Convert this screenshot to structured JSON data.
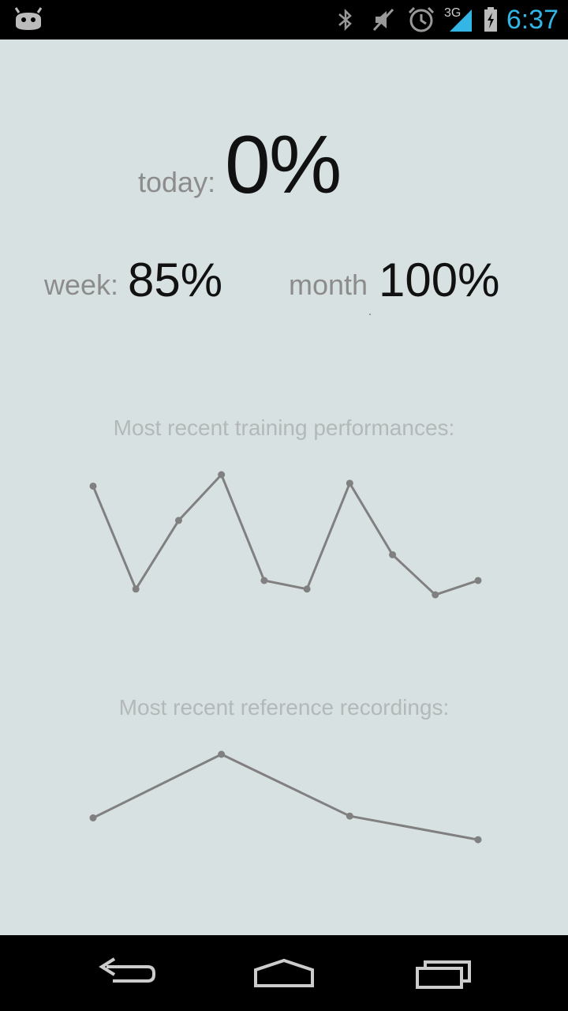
{
  "status_bar": {
    "time": "6:37",
    "network": "3G",
    "icons": [
      "android-icon",
      "bluetooth-icon",
      "mute-icon",
      "alarm-icon",
      "signal-icon",
      "battery-charging-icon"
    ]
  },
  "stats": {
    "today_label": "today:",
    "today_value": "0%",
    "week_label": "week:",
    "week_value": "85%",
    "month_label": "month",
    "month_value": "100%"
  },
  "chart_data": [
    {
      "type": "line",
      "title": "Most recent training performances:",
      "x": [
        1,
        2,
        3,
        4,
        5,
        6,
        7,
        8,
        9,
        10
      ],
      "series": [
        {
          "values": [
            0.92,
            0.2,
            0.68,
            1.0,
            0.26,
            0.2,
            0.94,
            0.44,
            0.16,
            0.26
          ]
        }
      ],
      "ylim": [
        0,
        1
      ],
      "grid": false
    },
    {
      "type": "line",
      "title": "Most recent reference recordings:",
      "x": [
        1,
        2,
        3,
        4
      ],
      "series": [
        {
          "values": [
            0.3,
            1.0,
            0.32,
            0.06
          ]
        }
      ],
      "ylim": [
        0,
        1
      ],
      "grid": false
    }
  ],
  "colors": {
    "line": "#808080",
    "background": "#d8e1e1",
    "status_accent": "#33b5e5"
  },
  "nav_bar": {
    "buttons": [
      "back-icon",
      "home-icon",
      "recent-apps-icon"
    ]
  }
}
